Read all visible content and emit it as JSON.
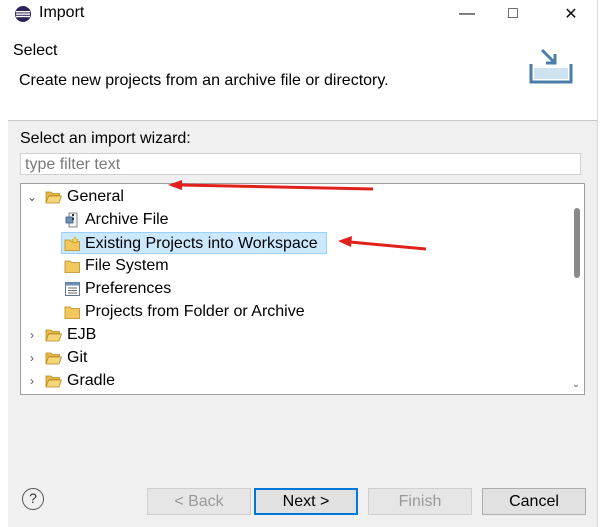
{
  "window": {
    "title": "Import",
    "minimize_glyph": "—",
    "maximize_glyph": "□",
    "close_glyph": "✕"
  },
  "header": {
    "title": "Select",
    "description": "Create new projects from an archive file or directory."
  },
  "wizard": {
    "label": "Select an import wizard:",
    "filter_placeholder": "type filter text"
  },
  "tree": [
    {
      "label": "General",
      "expanded": true,
      "icon": "folder-open-icon",
      "children": [
        {
          "label": "Archive File",
          "icon": "archive-file-icon"
        },
        {
          "label": "Existing Projects into Workspace",
          "icon": "existing-projects-icon",
          "selected": true
        },
        {
          "label": "File System",
          "icon": "folder-icon"
        },
        {
          "label": "Preferences",
          "icon": "preferences-icon"
        },
        {
          "label": "Projects from Folder or Archive",
          "icon": "folder-icon"
        }
      ]
    },
    {
      "label": "EJB",
      "expanded": false,
      "icon": "folder-icon"
    },
    {
      "label": "Git",
      "expanded": false,
      "icon": "folder-icon"
    },
    {
      "label": "Gradle",
      "expanded": false,
      "icon": "folder-icon"
    }
  ],
  "buttons": {
    "help": "?",
    "back": "< Back",
    "next": "Next >",
    "finish": "Finish",
    "cancel": "Cancel"
  },
  "colors": {
    "accent": "#0078d7",
    "annotation_arrow": "#e0201c",
    "selection": "#cce8ff"
  }
}
